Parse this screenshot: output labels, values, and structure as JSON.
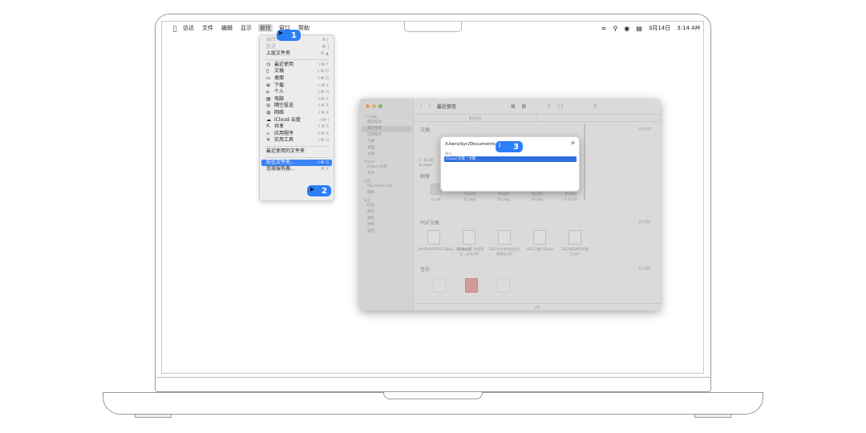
{
  "menubar": {
    "items": [
      "访达",
      "文件",
      "编辑",
      "显示",
      "前往",
      "窗口",
      "帮助"
    ],
    "status": {
      "date": "3月14日",
      "time": "3:14 AM"
    }
  },
  "go_menu": {
    "items": [
      {
        "label": "返回",
        "shortcut": "⌘ [",
        "disabled": true
      },
      {
        "label": "前进",
        "shortcut": "⌘ ]",
        "disabled": true
      },
      {
        "label": "上层文件夹",
        "shortcut": "⌘ ▲"
      },
      {
        "sep": true
      },
      {
        "label": "最近使用",
        "icon": "clock-icon",
        "shortcut": "⇧⌘ F"
      },
      {
        "label": "文稿",
        "icon": "document-icon",
        "shortcut": "⇧⌘ O"
      },
      {
        "label": "桌面",
        "icon": "desktop-icon",
        "shortcut": "⇧⌘ D"
      },
      {
        "label": "下载",
        "icon": "download-icon",
        "shortcut": "⌥⌘ L"
      },
      {
        "label": "个人",
        "icon": "home-icon",
        "shortcut": "⇧⌘ H"
      },
      {
        "label": "电脑",
        "icon": "computer-icon",
        "shortcut": "⇧⌘ C"
      },
      {
        "label": "隔空投送",
        "icon": "airdrop-icon",
        "shortcut": "⇧⌘ R"
      },
      {
        "label": "网络",
        "icon": "network-icon",
        "shortcut": "⇧⌘ K"
      },
      {
        "label": "iCloud 云盘",
        "icon": "cloud-icon",
        "shortcut": "⇧⌘ I"
      },
      {
        "label": "共享",
        "icon": "shared-icon",
        "shortcut": "⇧⌘ S"
      },
      {
        "label": "应用程序",
        "icon": "apps-icon",
        "shortcut": "⇧⌘ A"
      },
      {
        "label": "实用工具",
        "icon": "tools-icon",
        "shortcut": "⇧⌘ U"
      },
      {
        "sep": true
      },
      {
        "label": "最近使用的文件夹",
        "shortcut": "›"
      },
      {
        "sep": true
      },
      {
        "label": "前往文件夹...",
        "shortcut": "⇧⌘ G",
        "selected": true
      },
      {
        "label": "连接服务器...",
        "shortcut": "⌘ K"
      }
    ]
  },
  "badges": {
    "step1": "1",
    "step2": "2",
    "step3": "3"
  },
  "finder": {
    "title": "最近使用",
    "sidebar": [
      {
        "type": "head",
        "label": "个人收藏"
      },
      {
        "label": "隔空投送"
      },
      {
        "label": "最近使用",
        "current": true
      },
      {
        "label": "应用程序"
      },
      {
        "label": "下载"
      },
      {
        "label": "桌面"
      },
      {
        "label": "文稿"
      },
      {
        "type": "head",
        "label": "iCloud"
      },
      {
        "label": "iCloud 云盘"
      },
      {
        "label": "共享"
      },
      {
        "type": "head",
        "label": "位置"
      },
      {
        "label": "Macintosh HD"
      },
      {
        "label": "网络"
      },
      {
        "type": "head",
        "label": "标签"
      },
      {
        "label": "红色"
      },
      {
        "label": "橙色"
      },
      {
        "label": "黄色"
      },
      {
        "label": "绿色"
      },
      {
        "label": "蓝色"
      }
    ],
    "sections": {
      "docs": "文稿",
      "images": "图像",
      "pdf": "PDF文稿",
      "music": "音乐",
      "more": "显示更多"
    },
    "doc_files": [
      "3 - 演示管",
      "系.pages"
    ],
    "image_files": [
      "01.gif",
      "01.png",
      "01.png",
      "01.png",
      "2.1-1.tif"
    ],
    "pdf_files": [
      "_def49c669320c2bb6c...421b.pdf",
      "【金融实战】金鱼营支...公司.pdf",
      "2021年大学生创业大赛报告.pdf",
      "2021王者三国.pdf",
      "2022年高考写作题目.pdf"
    ],
    "status": "2项"
  },
  "goto_dialog": {
    "path": "/Users/kyc/Documents",
    "recent_label": "最近",
    "result": "iCloud 云盘 › 文稿",
    "close": "⊗"
  }
}
